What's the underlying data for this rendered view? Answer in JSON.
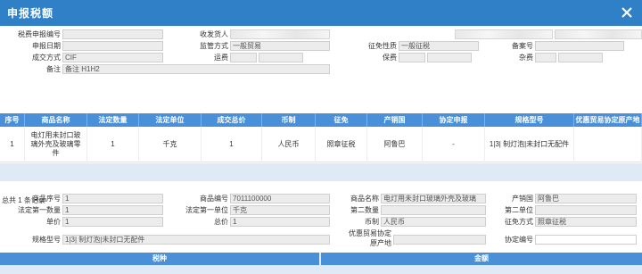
{
  "window": {
    "title": "申报税额"
  },
  "header_form": {
    "row1": {
      "tax_no_label": "税费申报编号",
      "consignee_label": "收发货人"
    },
    "row2": {
      "declare_date_label": "申报日期",
      "supervision_label": "监管方式",
      "supervision_value": "一般贸易",
      "levy_label": "征免性质",
      "levy_value": "一般征税",
      "record_no_label": "备案号"
    },
    "row3": {
      "deal_mode_label": "成交方式",
      "deal_mode_value": "CIF",
      "freight_label": "运费",
      "insurance_label": "保费",
      "misc_label": "杂费"
    },
    "row4": {
      "remark_label": "备注",
      "remark_value": "备注 H1H2"
    }
  },
  "grid": {
    "columns": [
      "序号",
      "商品名称",
      "法定数量",
      "法定单位",
      "成交总价",
      "币制",
      "征免",
      "产销国",
      "协定申报",
      "规格型号",
      "优惠贸易协定原产地"
    ],
    "rows": [
      [
        "1",
        "电灯用未封口玻璃外壳及玻璃零件",
        "1",
        "千克",
        "1",
        "人民币",
        "照章征税",
        "阿鲁巴",
        "-",
        "1|3| 制灯泡|未封口无配件",
        ""
      ]
    ]
  },
  "total_text": "总共 1 条记录",
  "detail_form": {
    "seq_label": "商品序号",
    "seq_value": "1",
    "code_label": "商品编号",
    "code_value": "7011100000",
    "name_label": "商品名称",
    "name_value": "电灯用未封口玻璃外壳及玻璃",
    "origin_label": "产销国",
    "origin_value": "阿鲁巴",
    "legal_qty1_label": "法定第一数量",
    "legal_qty1_value": "1",
    "legal_unit1_label": "法定第一单位",
    "legal_unit1_value": "千克",
    "qty2_label": "第二数量",
    "unit2_label": "第二单位",
    "price_label": "单价",
    "price_value": "1",
    "total_label": "总价",
    "total_value": "1",
    "currency_label": "币制",
    "currency_value": "人民币",
    "levy_mode_label": "征免方式",
    "levy_mode_value": "照章征税",
    "spec_label": "规格型号",
    "spec_value": "1|3| 制灯泡|未封口无配件",
    "pref_origin_label_1": "优惠贸易协定",
    "pref_origin_label_2": "原产地",
    "agreement_no_label": "协定编号"
  },
  "bottom_grid": {
    "col1": "税种",
    "col2": "金额"
  },
  "icons": {
    "close": "close-icon"
  },
  "colors": {
    "titlebar": "#2f80c6",
    "grid_header": "#4a90d9",
    "grid_empty": "#dfeaf6"
  }
}
